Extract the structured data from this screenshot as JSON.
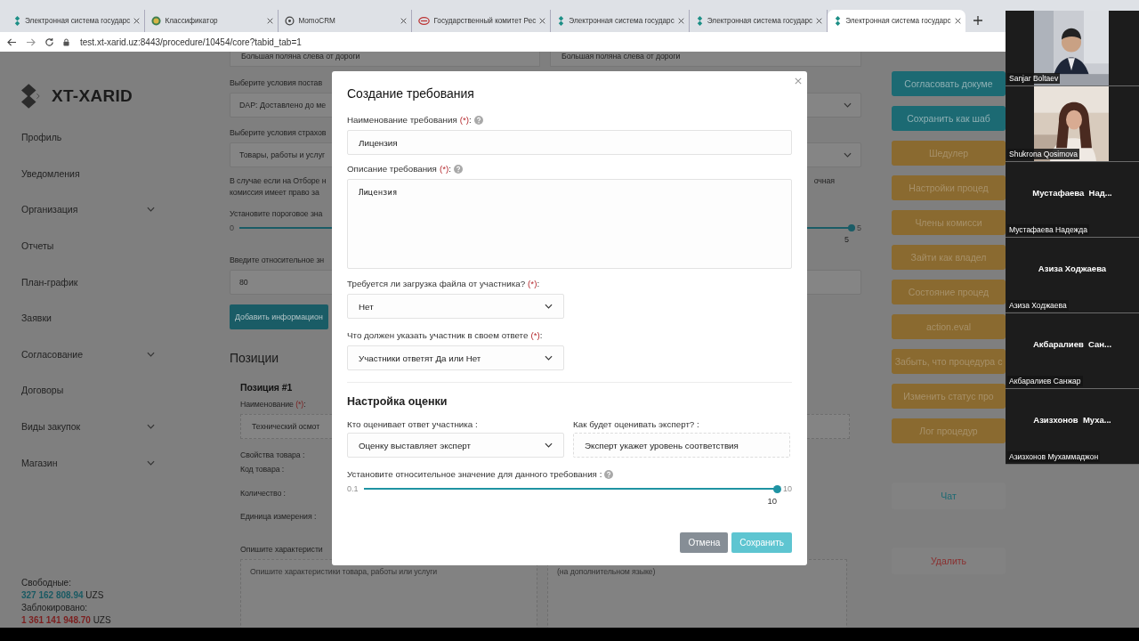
{
  "browser": {
    "tabs": [
      {
        "title": "Электронная система государс",
        "selected": false
      },
      {
        "title": "Классификатор",
        "selected": false
      },
      {
        "title": "MomoCRM",
        "selected": false
      },
      {
        "title": "Государственный комитет Рес",
        "selected": false
      },
      {
        "title": "Электронная система государс",
        "selected": false
      },
      {
        "title": "Электронная система государс",
        "selected": false
      },
      {
        "title": "Электронная система государс",
        "selected": true
      }
    ],
    "address": "test.xt-xarid.uz:8443/procedure/10454/core?tabid_tab=1"
  },
  "sidebar": {
    "logo": "XT-XARID",
    "items": [
      {
        "label": "Профиль",
        "expandable": false
      },
      {
        "label": "Уведомления",
        "expandable": false
      },
      {
        "label": "Организация",
        "expandable": true
      },
      {
        "label": "Отчеты",
        "expandable": false
      },
      {
        "label": "План-график",
        "expandable": false
      },
      {
        "label": "Заявки",
        "expandable": false
      },
      {
        "label": "Согласование",
        "expandable": true
      },
      {
        "label": "Договоры",
        "expandable": false
      },
      {
        "label": "Виды закупок",
        "expandable": true
      },
      {
        "label": "Магазин",
        "expandable": true
      }
    ],
    "balance": [
      {
        "label": "Свободные:",
        "amount": "327 162 808.94",
        "currency": "UZS",
        "kind": "free"
      },
      {
        "label": "Заблокировано:",
        "amount": "1 361 141 948.70",
        "currency": "UZS",
        "kind": "blocked"
      }
    ]
  },
  "main": {
    "top_fields": [
      "Большая поляна слева от дороги",
      "Большая поляна слева от дороги"
    ],
    "rows": [
      {
        "kind": "label",
        "text": "Выберите условия постав"
      },
      {
        "kind": "select",
        "value": "DAP: Доставлено до ме"
      },
      {
        "kind": "label",
        "text": "Выберите условия страхов"
      },
      {
        "kind": "select",
        "value": "Товары, работы и услуг"
      },
      {
        "kind": "note",
        "lines": [
          "В случае если на Отборе н",
          "комиссия имеет право за"
        ],
        "right_fragment": "очная"
      },
      {
        "kind": "label",
        "text": "Установите пороговое зна"
      },
      {
        "kind": "slider",
        "min": "0",
        "max": "5",
        "value": "5",
        "level": 1
      },
      {
        "kind": "label",
        "text": "Введите относительное зн"
      },
      {
        "kind": "input",
        "value": "80"
      },
      {
        "kind": "button",
        "text": "Добавить информацион"
      }
    ],
    "positions": {
      "title": "Позиции",
      "items": [
        {
          "title": "Позиция #1",
          "name_label": "Наименование",
          "required_mark": "(*)",
          "suffix": ":",
          "name_value": "Технический осмот",
          "properties": [
            "Свойства товара :",
            "Код товара :",
            "Количество :",
            "Единица измерения :"
          ],
          "description_label": "Опишите характеристи",
          "description_placeholder": "Опишите характеристики товара, работы или услуги",
          "translation_placeholder": "(на дополнительном языке)"
        }
      ]
    }
  },
  "actions": {
    "buttons": [
      {
        "label": "Согласовать докуме",
        "kind": "primary"
      },
      {
        "label": "Сохранить как шаб",
        "kind": "primary"
      },
      {
        "label": "Шедулер",
        "kind": "warning"
      },
      {
        "label": "Настройки процед",
        "kind": "warning"
      },
      {
        "label": "Члены комисси",
        "kind": "warning"
      },
      {
        "label": "Зайти как владел",
        "kind": "warning"
      },
      {
        "label": "Состояние процед",
        "kind": "warning"
      },
      {
        "label": "action.eval",
        "kind": "warning"
      },
      {
        "label": "Забыть, что процедура с",
        "kind": "warning"
      },
      {
        "label": "Изменить статус про",
        "kind": "warning"
      },
      {
        "label": "Лог процедур",
        "kind": "warning"
      }
    ],
    "links": [
      {
        "label": "Чат",
        "kind": "chat"
      },
      {
        "label": "Удалить",
        "kind": "danger"
      }
    ]
  },
  "modal": {
    "title": "Создание требования",
    "fields": [
      {
        "kind": "input",
        "label": "Наименование требования",
        "required_mark": "(*)",
        "suffix": ":",
        "help": true,
        "value": "Лицензия"
      },
      {
        "kind": "textarea",
        "label": "Описание требования",
        "required_mark": "(*)",
        "suffix": ":",
        "help": true,
        "value": "Лицензия"
      },
      {
        "kind": "select",
        "label": "Требуется ли загрузка файла от участника?",
        "required_mark": "(*)",
        "suffix": ":",
        "value": "Нет"
      },
      {
        "kind": "select",
        "label": "Что должен указать участник в своем ответе",
        "required_mark": "(*)",
        "suffix": ":",
        "value": "Участники ответят Да или Нет"
      }
    ],
    "section": {
      "title": "Настройка оценки",
      "columns": [
        {
          "kind": "select",
          "label": "Кто оценивает ответ участника :",
          "value": "Оценку выставляет эксперт"
        },
        {
          "kind": "readonly",
          "label": "Как будет оценивать эксперт? :",
          "value": "Эксперт укажет уровень соответствия"
        }
      ],
      "slider": {
        "label": "Установите относительное значение для данного требования :",
        "help": true,
        "min": "0.1",
        "max": "10",
        "value": "10",
        "level": 1
      }
    },
    "buttons": [
      {
        "label": "Отмена",
        "kind": "secondary"
      },
      {
        "label": "Сохранить",
        "kind": "primary"
      }
    ]
  },
  "video_panel": {
    "participants": [
      {
        "name": "Sanjar Boltaev",
        "video": true
      },
      {
        "name": "Shukrona Qosimova",
        "video": true
      },
      {
        "name": "Мустафаева Надежда",
        "display": "Мустафаева  Над...",
        "video": false
      },
      {
        "name": "Азиза Ходжаева",
        "display": "Азиза Ходжаева",
        "video": false
      },
      {
        "name": "Акбаралиев Санжар",
        "display": "Акбаралиев  Сан...",
        "video": false
      },
      {
        "name": "Азизхонов Мухаммаджон",
        "display": "Азизхонов  Муха...",
        "video": false
      }
    ]
  }
}
